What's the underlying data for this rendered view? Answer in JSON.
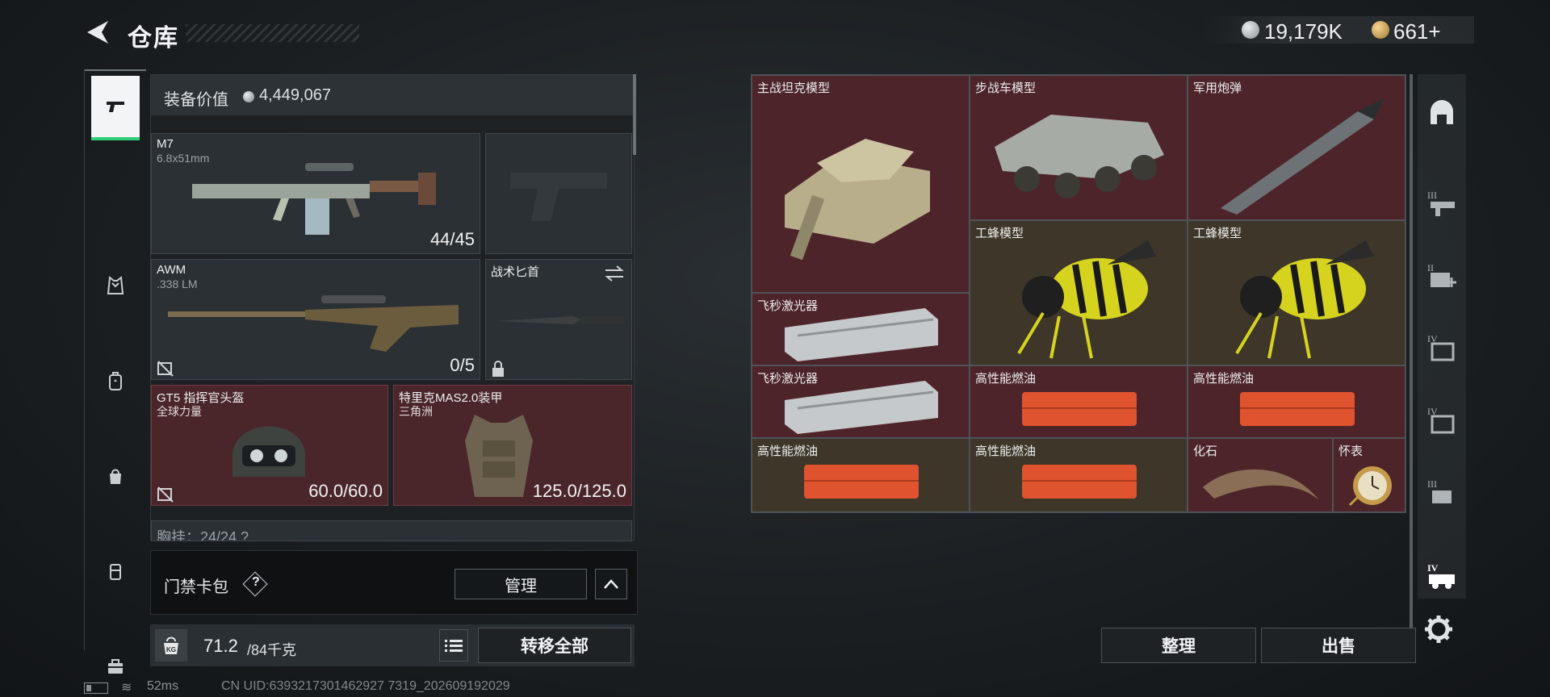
{
  "header": {
    "title": "仓库",
    "currency_primary": "19,179K",
    "currency_secondary": "661+"
  },
  "equipment": {
    "value_label": "装备价值",
    "value": "4,449,067",
    "primary_weapon": {
      "name": "M7",
      "caliber": "6.8x51mm",
      "ammo": "44/45"
    },
    "secondary_weapon": {
      "name": "AWM",
      "caliber": ".338 LM",
      "ammo": "0/5"
    },
    "melee": {
      "name": "战术匕首"
    },
    "helmet": {
      "name": "GT5 指挥官头盔",
      "sub": "全球力量",
      "durability": "60.0/60.0"
    },
    "armor": {
      "name": "特里克MAS2.0装甲",
      "sub": "三角洲",
      "durability": "125.0/125.0"
    },
    "chest_rig_partial": "胸挂：24/24 ?"
  },
  "keybag": {
    "label": "门禁卡包",
    "help": "?",
    "manage": "管理"
  },
  "weight": {
    "current": "71.2",
    "max": "/84千克",
    "kg_icon": "KG",
    "transfer_all": "转移全部"
  },
  "status": {
    "ping": "52ms",
    "uid": "CN UID:6393217301462927 7319_202609192029"
  },
  "stash": {
    "items": [
      {
        "name": "主战坦克模型"
      },
      {
        "name": "步战车模型"
      },
      {
        "name": "军用炮弹"
      },
      {
        "name": "工蜂模型"
      },
      {
        "name": "工蜂模型"
      },
      {
        "name": "飞秒激光器"
      },
      {
        "name": "飞秒激光器"
      },
      {
        "name": "高性能燃油"
      },
      {
        "name": "高性能燃油"
      },
      {
        "name": "高性能燃油"
      },
      {
        "name": "高性能燃油"
      },
      {
        "name": "化石"
      },
      {
        "name": "怀表"
      }
    ],
    "tidy": "整理",
    "sell": "出售"
  },
  "right_categories": [
    "arch-icon",
    "III-gun-icon",
    "II-medkit-icon",
    "IV-box-icon",
    "IV-box-icon",
    "III-rig-icon",
    "IV-vehicle-icon"
  ],
  "colors": {
    "accent_green": "#2fd07a",
    "rare_red": "#4d2429",
    "common_brown": "#3d3629"
  }
}
